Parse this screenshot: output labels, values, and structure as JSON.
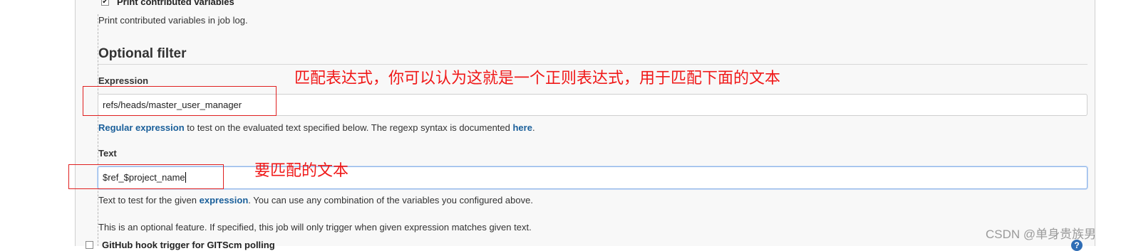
{
  "print_vars": {
    "checkbox_label": "Print contributed variables",
    "checked_mark": "✔",
    "help": "Print contributed variables in job log."
  },
  "optional_filter": {
    "title": "Optional filter",
    "expression": {
      "label": "Expression",
      "value": "refs/heads/master_user_manager",
      "help_link": "Regular expression",
      "help_mid": " to test on the evaluated text specified below. The regexp syntax is documented ",
      "help_link2": "here",
      "help_end": "."
    },
    "text": {
      "label": "Text",
      "value": "$ref_$project_name",
      "help_pre": "Text to test for the given ",
      "help_link": "expression",
      "help_post": ". You can use any combination of the variables you configured above."
    },
    "note": "This is an optional feature. If specified, this job will only trigger when given expression matches given text."
  },
  "annotations": {
    "expression_note": "匹配表达式，你可以认为这就是一个正则表达式，用于匹配下面的文本",
    "text_note": "要匹配的文本"
  },
  "next_option": {
    "label": "GitHub hook trigger for GITScm polling"
  },
  "watermark": "CSDN @单身贵族男",
  "help_icon_glyph": "?",
  "colors": {
    "annotation": "#f01818",
    "link": "#1a5f9a",
    "focus": "#8fb5e8"
  }
}
